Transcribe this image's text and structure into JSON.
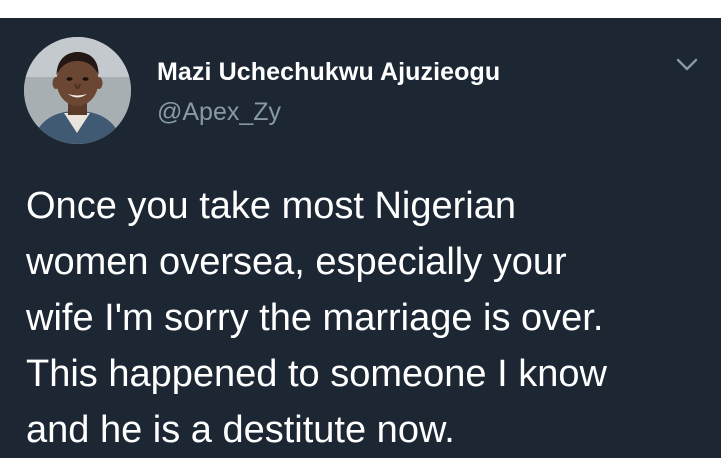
{
  "tweet": {
    "author_name": "Mazi Uchechukwu Ajuzieogu",
    "author_handle": "@Apex_Zy",
    "menu_icon": "chevron-down-icon",
    "avatar_icon": "profile-photo",
    "text_lines": [
      "Once you take most Nigerian",
      "women oversea, especially your",
      "wife I'm sorry the marriage is over.",
      "This happened to someone I know",
      "and he is a destitute now."
    ]
  },
  "colors": {
    "card_background": "#1c2733",
    "name_text": "#ffffff",
    "handle_text": "#8899a6",
    "body_text": "#ffffff",
    "chevron": "#8899a6",
    "page_background": "#ffffff"
  }
}
